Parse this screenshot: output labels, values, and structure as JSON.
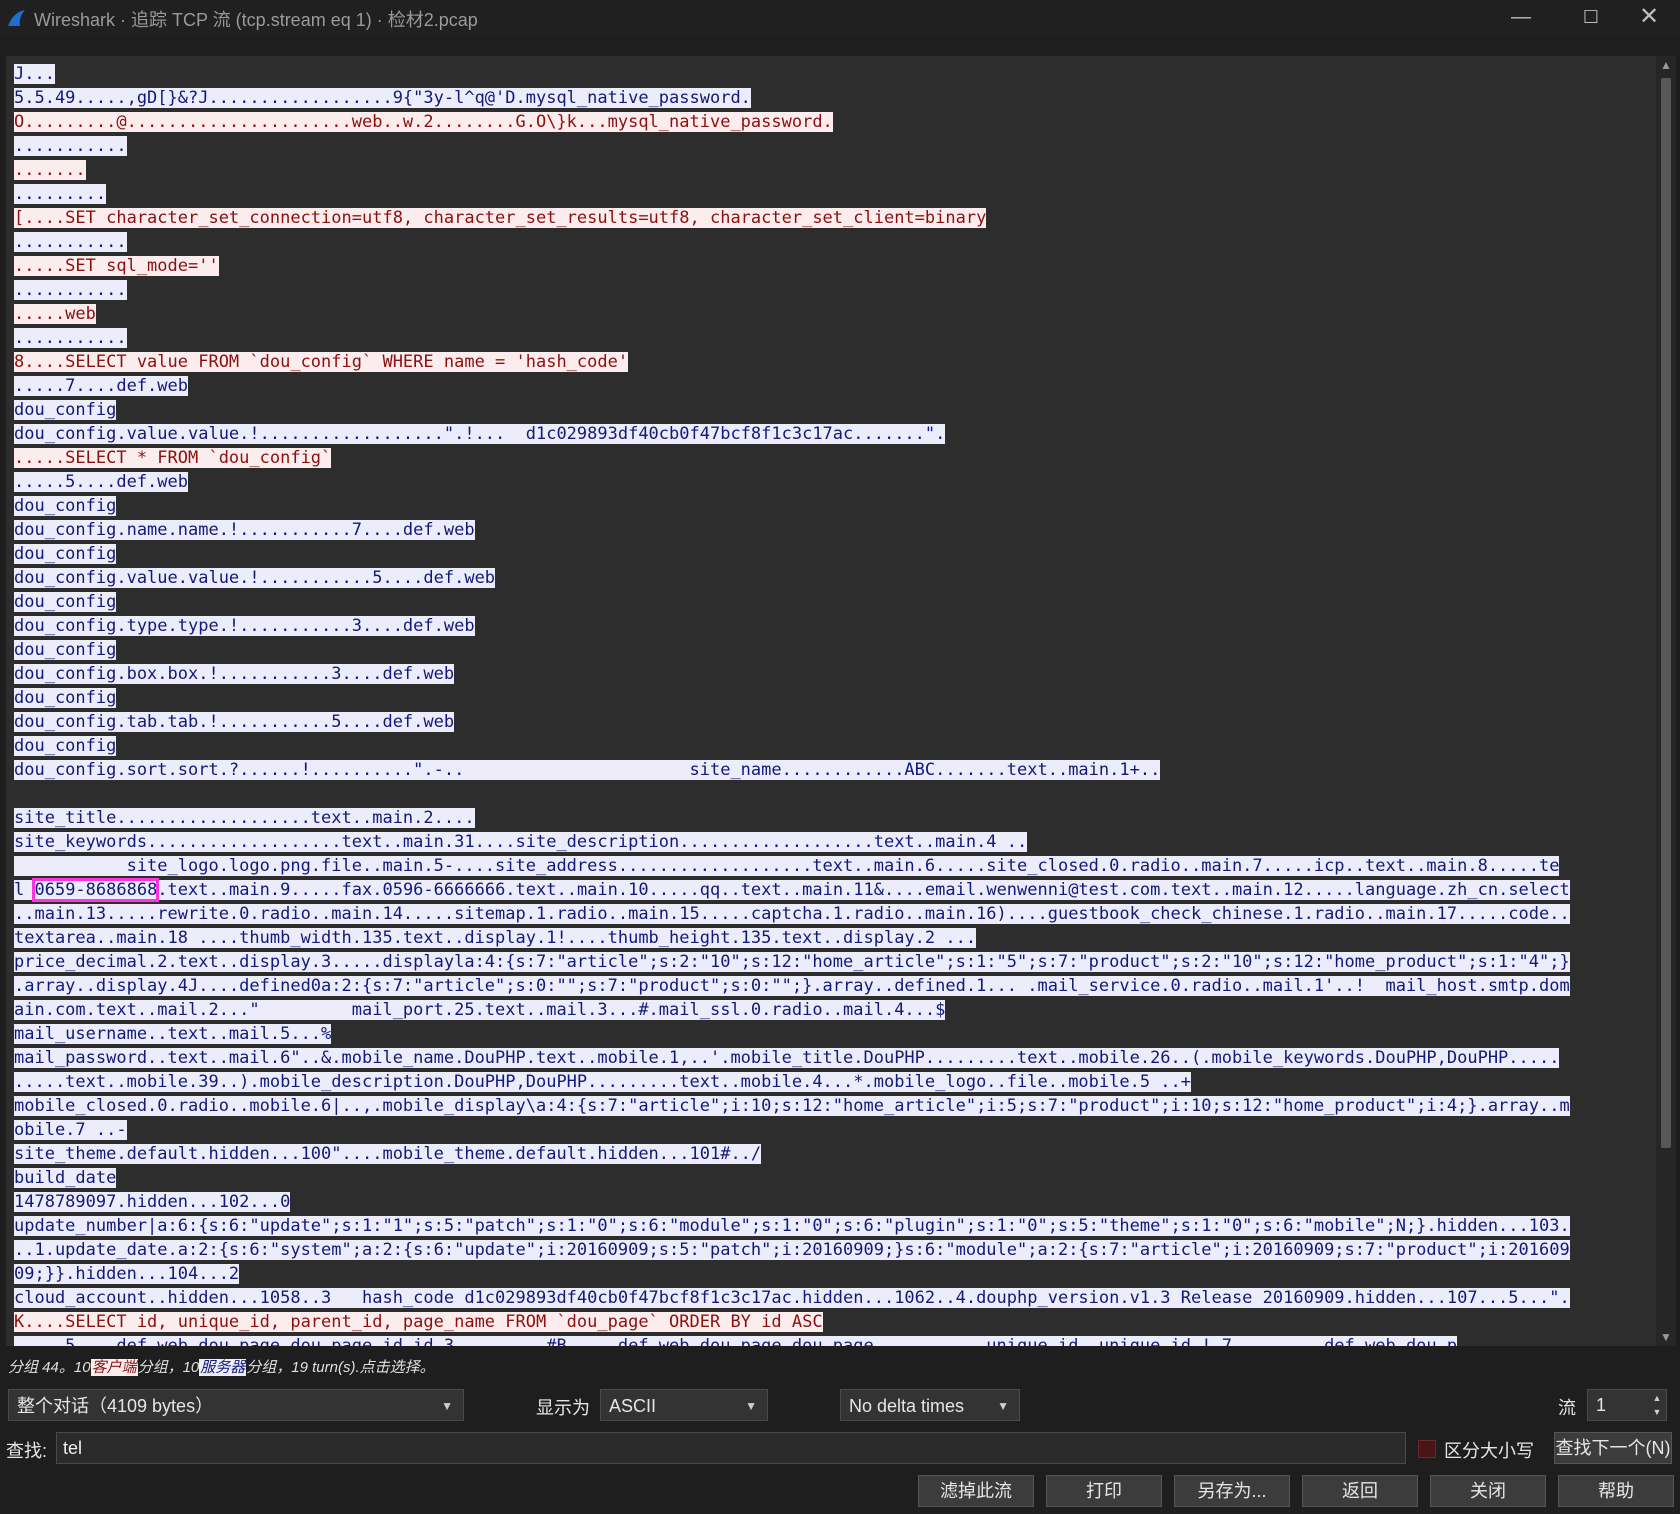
{
  "window": {
    "title": "Wireshark · 追踪 TCP 流 (tcp.stream eq 1) · 检材2.pcap",
    "minimize_icon": "minimize-icon",
    "maximize_icon": "maximize-icon",
    "close_icon": "close-icon"
  },
  "stream": {
    "lines": [
      [
        {
          "t": "J...",
          "c": "srv"
        }
      ],
      [
        {
          "t": "5.5.49.....,gD[}&?J..................9{\"3y-l^q@'D.mysql_native_password.",
          "c": "srv"
        }
      ],
      [
        {
          "t": "O.........@......................web..w.2........G.O\\}k...mysql_native_password.",
          "c": "cli"
        }
      ],
      [
        {
          "t": "...........",
          "c": "srv"
        }
      ],
      [
        {
          "t": ".......",
          "c": "cli"
        }
      ],
      [
        {
          "t": ".........",
          "c": "srv"
        }
      ],
      [
        {
          "t": "[....SET character_set_connection=utf8, character_set_results=utf8, character_set_client=binary",
          "c": "cli"
        }
      ],
      [
        {
          "t": "...........",
          "c": "srv"
        }
      ],
      [
        {
          "t": ".....SET sql_mode=''",
          "c": "cli"
        }
      ],
      [
        {
          "t": "...........",
          "c": "srv"
        }
      ],
      [
        {
          "t": ".....web",
          "c": "cli"
        }
      ],
      [
        {
          "t": "...........",
          "c": "srv"
        }
      ],
      [
        {
          "t": "8....SELECT value FROM `dou_config` WHERE name = 'hash_code'",
          "c": "cli"
        }
      ],
      [
        {
          "t": ".....7....def.web",
          "c": "srv"
        }
      ],
      [
        {
          "t": "dou_config",
          "c": "srv"
        }
      ],
      [
        {
          "t": "dou_config.value.value.!..................\".!...  d1c029893df40cb0f47bcf8f1c3c17ac.......\".",
          "c": "srv"
        }
      ],
      [
        {
          "t": ".....SELECT * FROM `dou_config`",
          "c": "cli"
        }
      ],
      [
        {
          "t": ".....5....def.web",
          "c": "srv"
        }
      ],
      [
        {
          "t": "dou_config",
          "c": "srv"
        }
      ],
      [
        {
          "t": "dou_config.name.name.!...........7....def.web",
          "c": "srv"
        }
      ],
      [
        {
          "t": "dou_config",
          "c": "srv"
        }
      ],
      [
        {
          "t": "dou_config.value.value.!...........5....def.web",
          "c": "srv"
        }
      ],
      [
        {
          "t": "dou_config",
          "c": "srv"
        }
      ],
      [
        {
          "t": "dou_config.type.type.!...........3....def.web",
          "c": "srv"
        }
      ],
      [
        {
          "t": "dou_config",
          "c": "srv"
        }
      ],
      [
        {
          "t": "dou_config.box.box.!...........3....def.web",
          "c": "srv"
        }
      ],
      [
        {
          "t": "dou_config",
          "c": "srv"
        }
      ],
      [
        {
          "t": "dou_config.tab.tab.!...........5....def.web",
          "c": "srv"
        }
      ],
      [
        {
          "t": "dou_config",
          "c": "srv"
        }
      ],
      [
        {
          "t": "dou_config.sort.sort.?......!..........\".-..                      site_name............ABC.......text..main.1+..",
          "c": "srv"
        }
      ],
      [
        {
          "t": "",
          "c": "srv"
        }
      ],
      [
        {
          "t": "site_title...................text..main.2....",
          "c": "srv"
        }
      ],
      [
        {
          "t": "site_keywords...................text..main.31....site_description...................text..main.4 ..",
          "c": "srv"
        }
      ],
      [
        {
          "t": "           site_logo.logo.png.file..main.5-....site_address...................text..main.6.....site_closed.0.radio..main.7.....icp..text..main.8.....te",
          "c": "srv"
        }
      ],
      [
        {
          "t": "l ",
          "c": "srv"
        },
        {
          "t": "0659-8686868",
          "c": "srv",
          "hit": true
        },
        {
          "t": ".text..main.9.....fax.0596-6666666.text..main.10.....qq..text..main.11&....email.wenwenni@test.com.text..main.12.....language.zh_cn.select",
          "c": "srv"
        }
      ],
      [
        {
          "t": "..main.13.....rewrite.0.radio..main.14.....sitemap.1.radio..main.15.....captcha.1.radio..main.16)....guestbook_check_chinese.1.radio..main.17.....code..",
          "c": "srv"
        }
      ],
      [
        {
          "t": "textarea..main.18 ....thumb_width.135.text..display.1!....thumb_height.135.text..display.2 ...",
          "c": "srv"
        }
      ],
      [
        {
          "t": "price_decimal.2.text..display.3.....displayla:4:{s:7:\"article\";s:2:\"10\";s:12:\"home_article\";s:1:\"5\";s:7:\"product\";s:2:\"10\";s:12:\"home_product\";s:1:\"4\";}",
          "c": "srv"
        }
      ],
      [
        {
          "t": ".array..display.4J....defined0a:2:{s:7:\"article\";s:0:\"\";s:7:\"product\";s:0:\"\";}.array..defined.1... .mail_service.0.radio..mail.1'..!  mail_host.smtp.dom",
          "c": "srv"
        }
      ],
      [
        {
          "t": "ain.com.text..mail.2...\"         mail_port.25.text..mail.3...#.mail_ssl.0.radio..mail.4...$",
          "c": "srv"
        }
      ],
      [
        {
          "t": "mail_username..text..mail.5...%",
          "c": "srv"
        }
      ],
      [
        {
          "t": "mail_password..text..mail.6\"..&.mobile_name.DouPHP.text..mobile.1,..'.mobile_title.DouPHP.........text..mobile.26..(.mobile_keywords.DouPHP,DouPHP.....",
          "c": "srv"
        }
      ],
      [
        {
          "t": ".....text..mobile.39..).mobile_description.DouPHP,DouPHP.........text..mobile.4...*.mobile_logo..file..mobile.5 ..+",
          "c": "srv"
        }
      ],
      [
        {
          "t": "mobile_closed.0.radio..mobile.6|..,.mobile_display\\a:4:{s:7:\"article\";i:10;s:12:\"home_article\";i:5;s:7:\"product\";i:10;s:12:\"home_product\";i:4;}.array..m",
          "c": "srv"
        }
      ],
      [
        {
          "t": "obile.7 ..-",
          "c": "srv"
        }
      ],
      [
        {
          "t": "site_theme.default.hidden...100\"....mobile_theme.default.hidden...101#../",
          "c": "srv"
        }
      ],
      [
        {
          "t": "build_date",
          "c": "srv"
        }
      ],
      [
        {
          "t": "1478789097.hidden...102...0",
          "c": "srv"
        }
      ],
      [
        {
          "t": "update_number|a:6:{s:6:\"update\";s:1:\"1\";s:5:\"patch\";s:1:\"0\";s:6:\"module\";s:1:\"0\";s:6:\"plugin\";s:1:\"0\";s:5:\"theme\";s:1:\"0\";s:6:\"mobile\";N;}.hidden...103.",
          "c": "srv"
        }
      ],
      [
        {
          "t": "..1.update_date.a:2:{s:6:\"system\";a:2:{s:6:\"update\";i:20160909;s:5:\"patch\";i:20160909;}s:6:\"module\";a:2:{s:7:\"article\";i:20160909;s:7:\"product\";i:201609",
          "c": "srv"
        }
      ],
      [
        {
          "t": "09;}}.hidden...104...2",
          "c": "srv"
        }
      ],
      [
        {
          "t": "cloud_account..hidden...1058..3   hash_code d1c029893df40cb0f47bcf8f1c3c17ac.hidden...1062..4.douphp_version.v1.3 Release 20160909.hidden...107...5...\".",
          "c": "srv"
        }
      ],
      [
        {
          "t": "K....SELECT id, unique_id, parent_id, page_name FROM `dou_page` ORDER BY id ASC",
          "c": "cli"
        }
      ],
      [
        {
          "t": ".....5....def.web.dou_page.dou_page.id.id.3.........#B.....def.web.dou_page.dou_page...........unique_id..unique_id.!.7.........def.web.dou_p",
          "c": "srv"
        }
      ]
    ]
  },
  "status": {
    "prefix": "分组 44。10",
    "client_label": "客户端",
    "middle": "分组，10",
    "server_label": "服务器",
    "suffix": "分组，19 turn(s).点击选择。"
  },
  "controls": {
    "conversation_select": "整个对话（4109 bytes）",
    "show_as_label": "显示为",
    "show_as_value": "ASCII",
    "delta_value": "No delta times",
    "stream_label": "流",
    "stream_value": "1"
  },
  "find": {
    "label": "查找:",
    "value": "tel",
    "case_label": "区分大小写",
    "find_next": "查找下一个(N)"
  },
  "buttons": {
    "filter_out": "滤掉此流",
    "print": "打印",
    "save_as": "另存为...",
    "back": "返回",
    "close": "关闭",
    "help": "帮助"
  },
  "colors": {
    "client_bg": "#fbeded",
    "client_fg": "#8b1010",
    "server_bg": "#ececfa",
    "server_fg": "#111a7a",
    "search_highlight": "#ff33e0"
  }
}
